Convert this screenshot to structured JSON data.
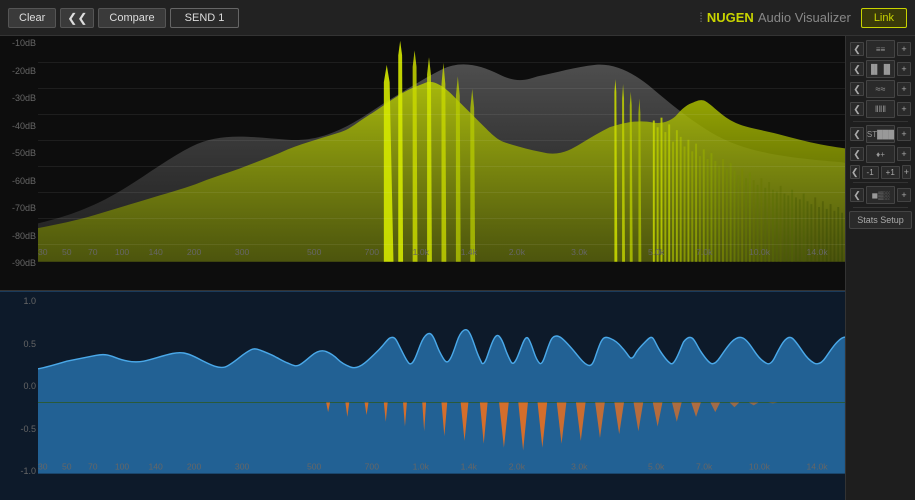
{
  "topbar": {
    "clear_label": "Clear",
    "compare_label": "Compare",
    "send_label": "SEND 1",
    "brand": "NUGEN",
    "title": "Audio Visualizer",
    "link_label": "Link"
  },
  "spectrum": {
    "db_labels": [
      "-10dB",
      "-20dB",
      "-30dB",
      "-40dB",
      "-50dB",
      "-60dB",
      "-70dB",
      "-80dB",
      "-90dB"
    ],
    "freq_labels": [
      "30",
      "50",
      "70",
      "100",
      "140",
      "200",
      "300",
      "500",
      "700",
      "1.0k",
      "1.4k",
      "2.0k",
      "3.0k",
      "5.0k",
      "7.0k",
      "10.0k",
      "14.0k"
    ]
  },
  "waveform": {
    "y_labels": [
      "1.0",
      "0.5",
      "0.0",
      "-0.5",
      "-1.0"
    ],
    "freq_labels": [
      "30",
      "50",
      "70",
      "100",
      "140",
      "200",
      "300",
      "500",
      "700",
      "1.0k",
      "1.4k",
      "2.0k",
      "3.0k",
      "5.0k",
      "7.0k",
      "10.0k",
      "14.0k"
    ]
  },
  "sidebar": {
    "items": [
      {
        "label": "≡≡≡",
        "name": "spectrum-lines"
      },
      {
        "label": "▌▌▌▌",
        "name": "bars"
      },
      {
        "label": "~~~",
        "name": "wave"
      },
      {
        "label": "|||",
        "name": "vert-lines"
      },
      {
        "label": "ST",
        "name": "stereo"
      },
      {
        "label": "◇",
        "name": "diamond"
      },
      {
        "label": "-1",
        "name": "minus-one"
      },
      {
        "label": "+1",
        "name": "plus-one"
      },
      {
        "label": "⬛",
        "name": "block"
      },
      {
        "label": "Stats\nSetup",
        "name": "stats-setup"
      }
    ]
  }
}
